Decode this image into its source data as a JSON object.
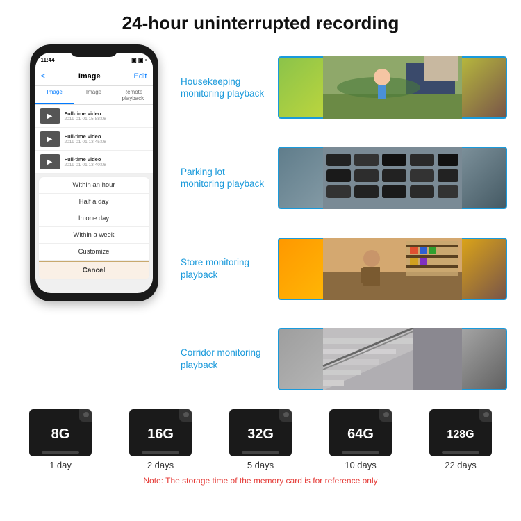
{
  "header": {
    "title": "24-hour uninterrupted recording"
  },
  "phone": {
    "time": "11:44",
    "back_label": "<",
    "screen_title": "Image",
    "edit_label": "Edit",
    "tabs": [
      "Image",
      "Image",
      "Remote playback"
    ],
    "videos": [
      {
        "title": "Full-time video",
        "date": "2019-01-01 15:88:08"
      },
      {
        "title": "Full-time video",
        "date": "2019-01-01 13:45:08"
      },
      {
        "title": "Full-time video",
        "date": "2019-01-01 13:40:08"
      }
    ],
    "dropdown_items": [
      "Within an hour",
      "Half a day",
      "In one day",
      "Within a week",
      "Customize"
    ],
    "cancel_label": "Cancel"
  },
  "monitoring": [
    {
      "label": "Housekeeping monitoring playback",
      "img_class": "img-housekeeping",
      "img_alt": "Housekeeping"
    },
    {
      "label": "Parking lot monitoring playback",
      "img_class": "img-parking",
      "img_alt": "Parking"
    },
    {
      "label": "Store monitoring playback",
      "img_class": "img-store",
      "img_alt": "Store"
    },
    {
      "label": "Corridor monitoring playback",
      "img_class": "img-corridor",
      "img_alt": "Corridor"
    }
  ],
  "memory_cards": [
    {
      "size": "8G",
      "days": "1 day"
    },
    {
      "size": "16G",
      "days": "2 days"
    },
    {
      "size": "32G",
      "days": "5 days"
    },
    {
      "size": "64G",
      "days": "10 days"
    },
    {
      "size": "128G",
      "days": "22 days"
    }
  ],
  "note": "Note: The storage time of the memory card is for reference only"
}
